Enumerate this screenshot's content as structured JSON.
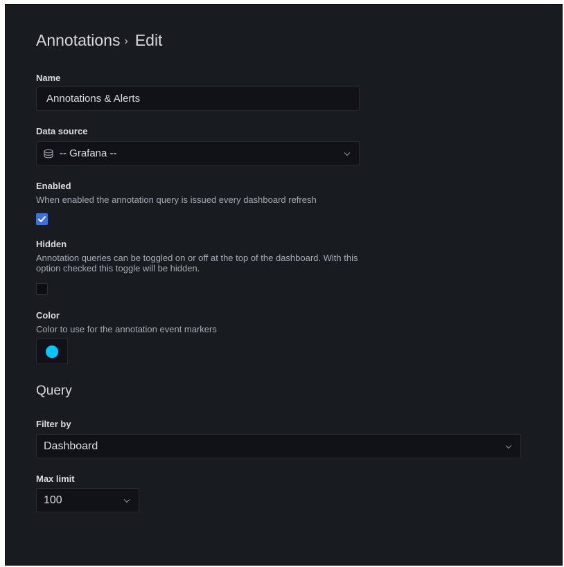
{
  "breadcrumb": {
    "parent": "Annotations",
    "separator": "›",
    "current": "Edit"
  },
  "name": {
    "label": "Name",
    "value": "Annotations & Alerts"
  },
  "data_source": {
    "label": "Data source",
    "value": "-- Grafana --",
    "icon": "database-icon"
  },
  "enabled": {
    "label": "Enabled",
    "description": "When enabled the annotation query is issued every dashboard refresh",
    "checked": true
  },
  "hidden": {
    "label": "Hidden",
    "description_line1": "Annotation queries can be toggled on or off at the top of the dashboard. With this",
    "description_line2": "option checked this toggle will be hidden.",
    "checked": false
  },
  "color": {
    "label": "Color",
    "description": "Color to use for the annotation event markers",
    "value": "#00c8ff"
  },
  "query": {
    "title": "Query",
    "filter_by": {
      "label": "Filter by",
      "value": "Dashboard"
    },
    "max_limit": {
      "label": "Max limit",
      "value": "100"
    }
  },
  "colors": {
    "background": "#181b1f",
    "input_background": "#111217",
    "checkbox_accent": "#3d71d9"
  }
}
